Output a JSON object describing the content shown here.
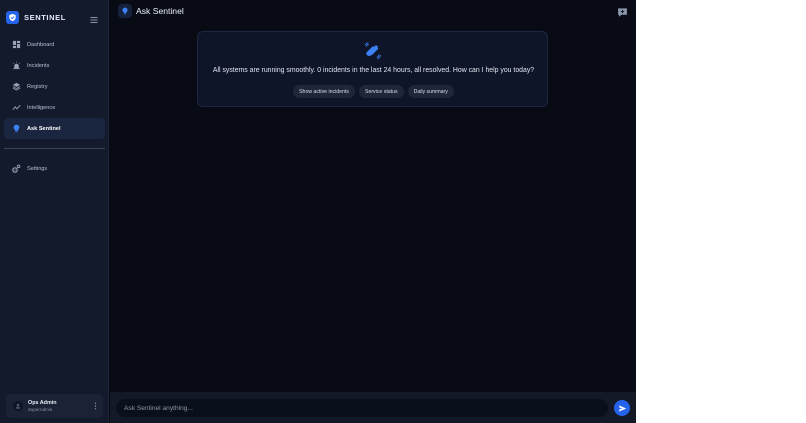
{
  "brand": {
    "name": "SENTINEL",
    "logo_icon": "shield-icon",
    "accent": "#2563eb"
  },
  "sidebar": {
    "items": [
      {
        "label": "Dashboard",
        "icon": "dashboard-icon",
        "active": false
      },
      {
        "label": "Incidents",
        "icon": "siren-icon",
        "active": false
      },
      {
        "label": "Registry",
        "icon": "layers-icon",
        "active": false
      },
      {
        "label": "Intelligence",
        "icon": "trend-icon",
        "active": false
      },
      {
        "label": "Ask Sentinel",
        "icon": "lightbulb-icon",
        "active": true
      }
    ],
    "settings": {
      "label": "Settings",
      "icon": "gear-icon"
    }
  },
  "user": {
    "name": "Ops Admin",
    "role": "SuperAdmin"
  },
  "header": {
    "title": "Ask Sentinel",
    "new_chat_icon": "new-chat-icon"
  },
  "welcome": {
    "icon": "wave-hand-icon",
    "message": "All systems are running smoothly. 0 incidents in the last 24 hours, all resolved. How can I help you today?",
    "suggestions": [
      "Show active incidents",
      "Service status",
      "Daily summary"
    ]
  },
  "composer": {
    "placeholder": "Ask Sentinel anything...",
    "value": "",
    "send_icon": "send-icon"
  }
}
